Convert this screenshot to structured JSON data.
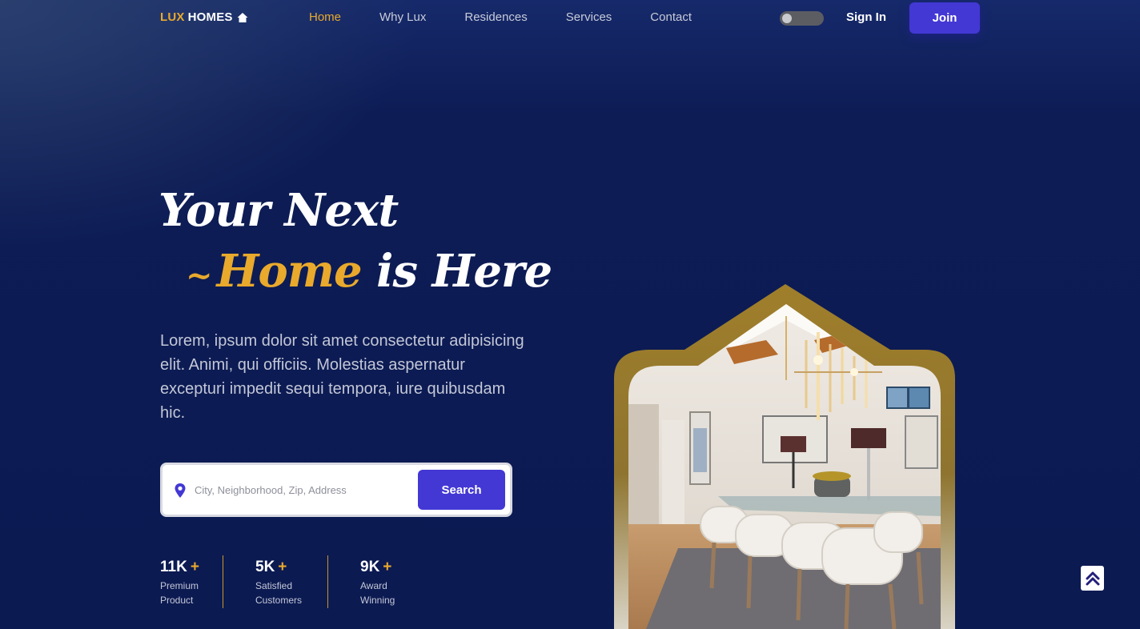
{
  "nav": {
    "logo_lux": "LUX",
    "logo_homes": "HOMES",
    "logo_icon": "house-icon",
    "items": [
      {
        "label": "Home",
        "active": true
      },
      {
        "label": "Why Lux",
        "active": false
      },
      {
        "label": "Residences",
        "active": false
      },
      {
        "label": "Services",
        "active": false
      },
      {
        "label": "Contact",
        "active": false
      }
    ],
    "theme_toggle": "off",
    "signin_label": "Sign In",
    "join_label": "Join"
  },
  "hero": {
    "line1": "Your Next",
    "tilde": "~",
    "line2_highlight": "Home",
    "line2_rest": "is Here",
    "description": "Lorem, ipsum dolor sit amet consectetur adipisicing elit. Animi, qui officiis. Molestias aspernatur excepturi impedit sequi tempora, iure quibusdam hic."
  },
  "search": {
    "icon": "map-pin-icon",
    "placeholder": "City, Neighborhood, Zip, Address",
    "value": "",
    "button_label": "Search"
  },
  "stats": [
    {
      "value": "11K",
      "plus": "+",
      "line1": "Premium",
      "line2": "Product"
    },
    {
      "value": "5K",
      "plus": "+",
      "line1": "Satisfied",
      "line2": "Customers"
    },
    {
      "value": "9K",
      "plus": "+",
      "line1": "Award",
      "line2": "Winning"
    }
  ],
  "image": {
    "subject": "dining-room-interior",
    "frame_color": "#a07f2b"
  },
  "scroll_top_icon": "double-chevron-up-icon",
  "colors": {
    "accent_gold": "#e8a92c",
    "primary_button": "#4338d4",
    "background": "#0c1a52"
  }
}
